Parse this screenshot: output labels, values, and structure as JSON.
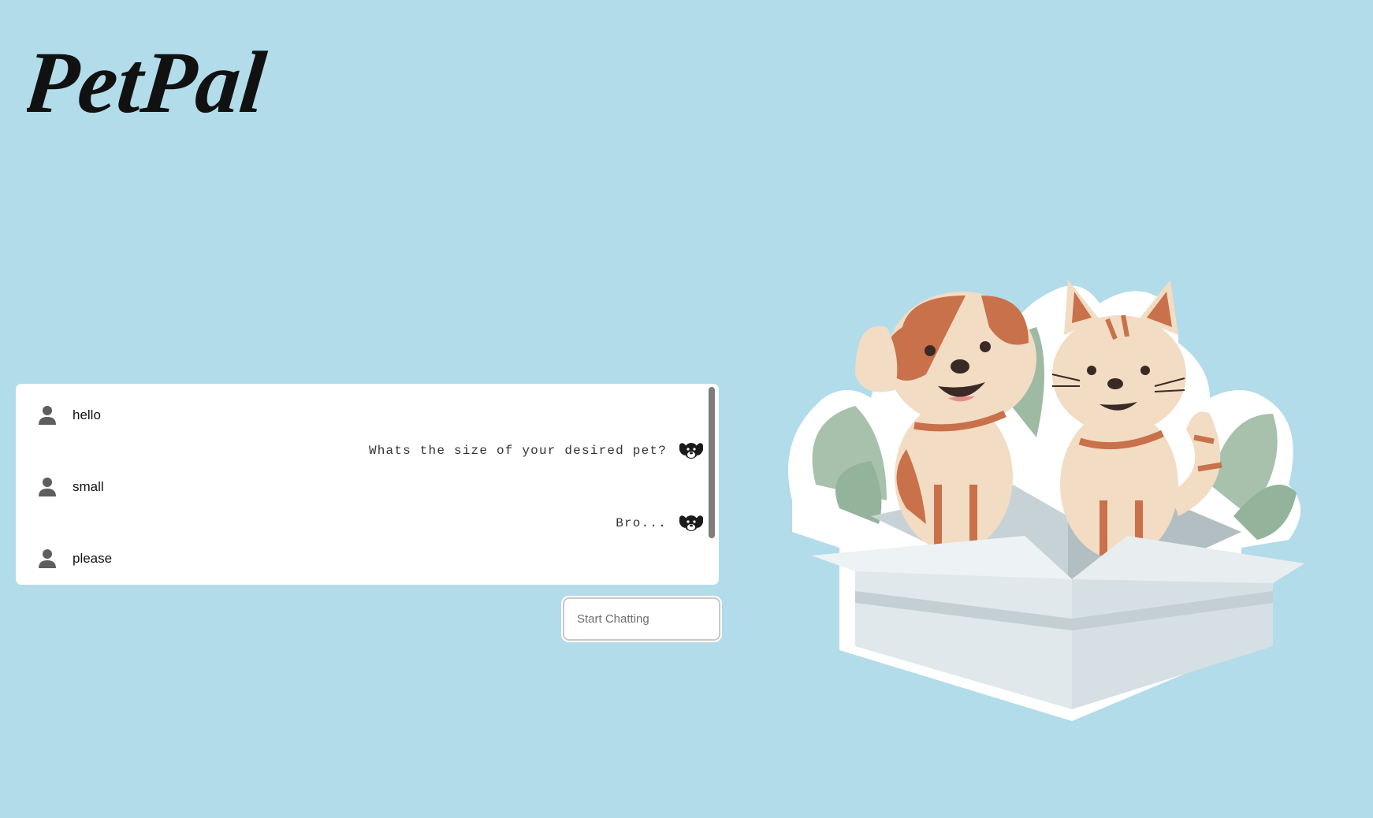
{
  "app": {
    "logo_text": "PetPal"
  },
  "chat": {
    "messages": [
      {
        "sender": "user",
        "text": "hello"
      },
      {
        "sender": "bot",
        "text": "Whats the size of your desired pet?"
      },
      {
        "sender": "user",
        "text": "small"
      },
      {
        "sender": "bot",
        "text": "Bro..."
      },
      {
        "sender": "user",
        "text": "please"
      }
    ],
    "icons": {
      "user": "user-icon",
      "bot": "dog-face-icon"
    }
  },
  "input": {
    "placeholder": "Start Chatting",
    "value": ""
  },
  "colors": {
    "background": "#b2dcea",
    "panel": "#ffffff",
    "logo": "#111111",
    "user_icon": "#5e5e5e"
  },
  "illustration": {
    "icon": "dog-and-cat-in-box-illustration"
  }
}
